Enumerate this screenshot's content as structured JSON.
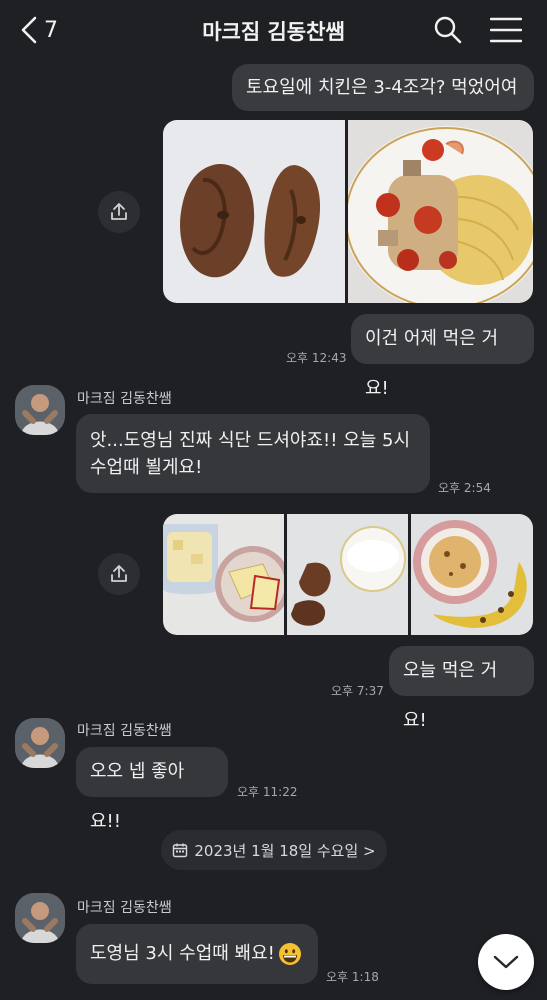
{
  "header": {
    "back_count": "7",
    "title": "마크짐 김동찬쌤"
  },
  "messages": {
    "m1": {
      "text": "토요일에 치킨은 3-4조각? 먹었어여"
    },
    "m2": {
      "text": "이건 어제 먹은 거요!",
      "time": "오후 12:43"
    },
    "m3": {
      "sender": "마크짐 김동찬쌤",
      "text": "앗...도영님 진짜 식단 드셔야죠!! 오늘 5시\n수업때 뵐게요!",
      "time": "오후 2:54"
    },
    "m4": {
      "text": "오늘 먹은 거요!",
      "time": "오후 7:37"
    },
    "m5": {
      "sender": "마크짐 김동찬쌤",
      "text": "오오 넵 좋아요!!",
      "time": "오후 11:22"
    },
    "m6": {
      "sender": "마크짐 김동찬쌤",
      "text": "도영님 3시 수업때 봬요!",
      "time": "오후 1:18"
    }
  },
  "date_divider": {
    "text": "2023년 1월 18일 수요일 >"
  },
  "colors": {
    "background": "#1f2024",
    "bubble": "#3a3b3f",
    "text": "#f0f0f2",
    "time": "#a6a7ab"
  },
  "icons": {
    "back": "chevron-left-icon",
    "search": "search-icon",
    "menu": "hamburger-menu-icon",
    "share": "share-icon",
    "calendar": "calendar-icon",
    "scroll_down": "chevron-down-icon",
    "emoji": "grinning-face-emoji"
  }
}
